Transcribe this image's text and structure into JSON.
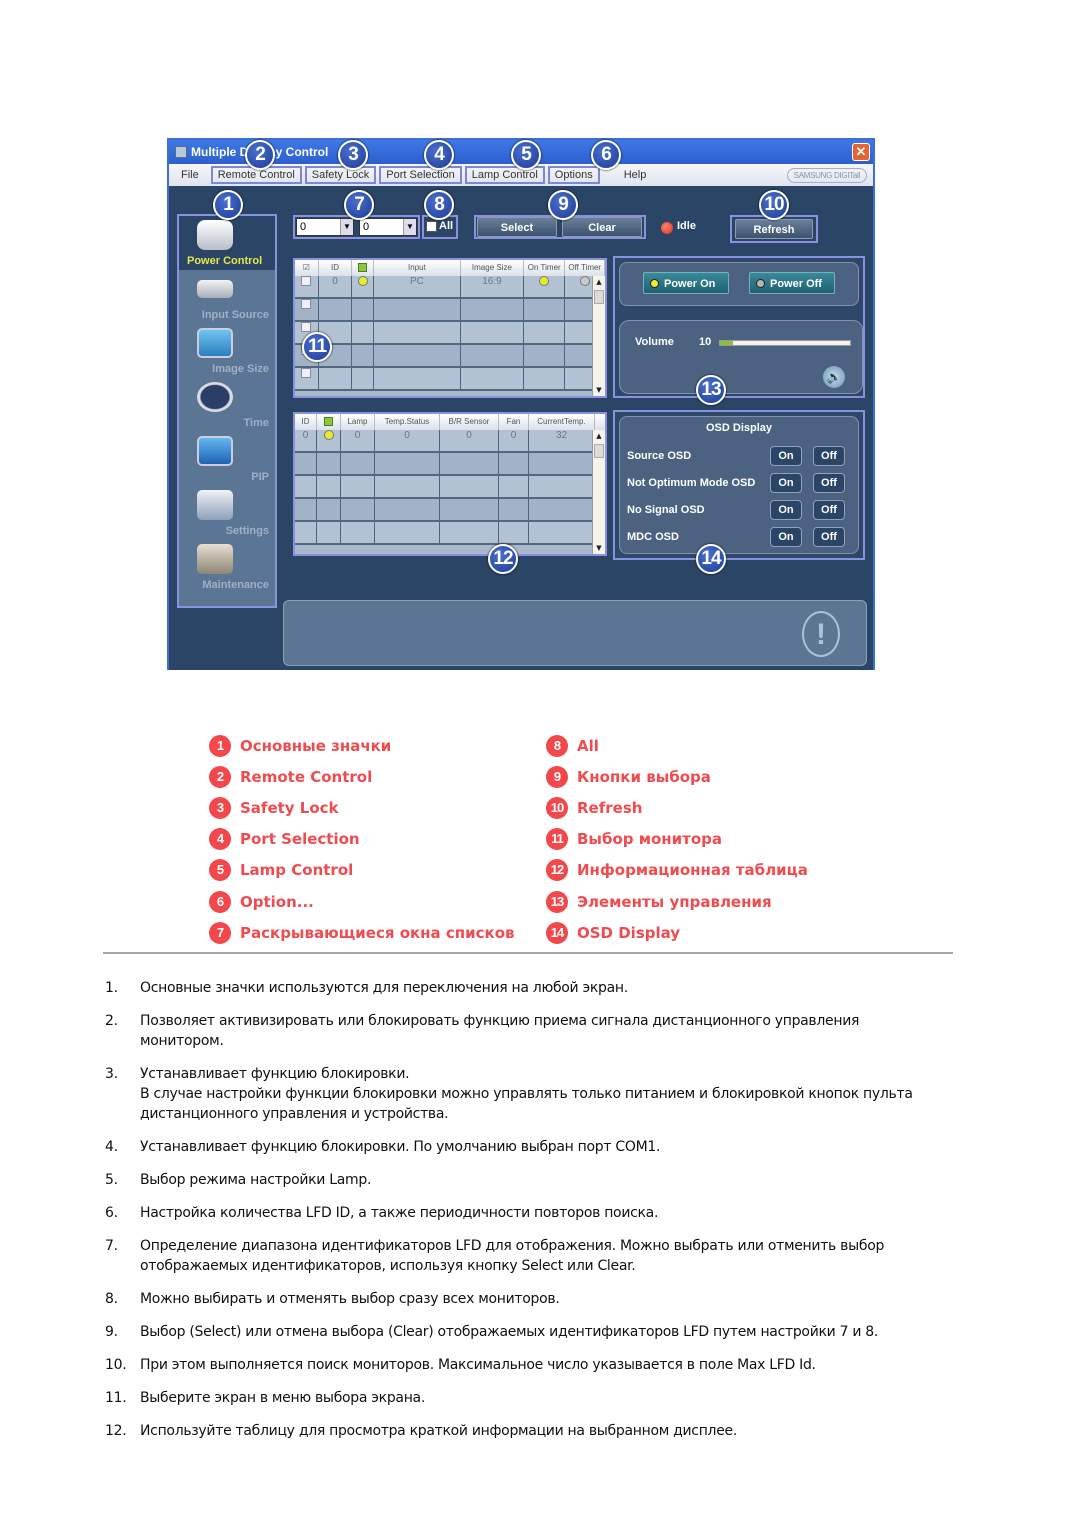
{
  "window": {
    "title": "Multiple Display Control",
    "close_glyph": "✕",
    "menu": [
      "File",
      "Remote Control",
      "Safety Lock",
      "Port Selection",
      "Lamp Control",
      "Options",
      "Help"
    ],
    "brand": "SAMSUNG DIGITall"
  },
  "sidebar": {
    "items": [
      {
        "label": "Power Control",
        "icon": "power-control-icon",
        "active": true
      },
      {
        "label": "Input Source",
        "icon": "input-source-icon"
      },
      {
        "label": "Image Size",
        "icon": "image-size-icon"
      },
      {
        "label": "Time",
        "icon": "clock-icon"
      },
      {
        "label": "PIP",
        "icon": "pip-icon"
      },
      {
        "label": "Settings",
        "icon": "settings-icon"
      },
      {
        "label": "Maintenance",
        "icon": "maintenance-icon"
      }
    ]
  },
  "controls": {
    "range_from": "0",
    "range_to": "0",
    "all_label": "All",
    "select_label": "Select",
    "clear_label": "Clear",
    "status": "Idle",
    "refresh_label": "Refresh",
    "dropdown_arrow": "▼"
  },
  "table_top": {
    "columns": [
      "☑",
      "ID",
      "",
      "Input",
      "Image Size",
      "On Timer",
      "Off Timer"
    ],
    "rows": [
      {
        "id": "0",
        "power": "on",
        "input": "PC",
        "image_size": "16:9",
        "on_timer": "on",
        "off_timer": "off"
      }
    ]
  },
  "table_bottom": {
    "columns": [
      "ID",
      "",
      "Lamp",
      "Temp.Status",
      "B/R Sensor",
      "Fan",
      "CurrentTemp."
    ],
    "rows": [
      {
        "id": "0",
        "power": "on",
        "lamp": "0",
        "temp_status": "0",
        "br_sensor": "0",
        "fan": "0",
        "current_temp": "32"
      }
    ]
  },
  "power_panel": {
    "power_on_label": "Power On",
    "power_off_label": "Power Off",
    "volume_label": "Volume",
    "volume_value": "10",
    "volume_fraction": 0.1,
    "speaker_glyph": "🔈"
  },
  "osd_panel": {
    "title": "OSD Display",
    "rows": [
      {
        "label": "Source OSD",
        "on": "On",
        "off": "Off"
      },
      {
        "label": "Not Optimum Mode OSD",
        "on": "On",
        "off": "Off"
      },
      {
        "label": "No Signal OSD",
        "on": "On",
        "off": "Off"
      },
      {
        "label": "MDC OSD",
        "on": "On",
        "off": "Off"
      }
    ]
  },
  "message_box": {
    "warning_glyph": "!"
  },
  "callouts": [
    "1",
    "2",
    "3",
    "4",
    "5",
    "6",
    "7",
    "8",
    "9",
    "10",
    "11",
    "12",
    "13",
    "14"
  ],
  "legend": {
    "left": [
      {
        "num": "1",
        "text": "Основные значки"
      },
      {
        "num": "2",
        "text": "Remote Control"
      },
      {
        "num": "3",
        "text": "Safety Lock"
      },
      {
        "num": "4",
        "text": "Port Selection"
      },
      {
        "num": "5",
        "text": "Lamp Control"
      },
      {
        "num": "6",
        "text": "Option..."
      },
      {
        "num": "7",
        "text": "Раскрывающиеся окна списков"
      }
    ],
    "right": [
      {
        "num": "8",
        "text": "All"
      },
      {
        "num": "9",
        "text": "Кнопки выбора"
      },
      {
        "num": "10",
        "text": "Refresh"
      },
      {
        "num": "11",
        "text": "Выбор монитора"
      },
      {
        "num": "12",
        "text": "Информационная таблица"
      },
      {
        "num": "13",
        "text": "Элементы управления"
      },
      {
        "num": "14",
        "text": "OSD Display"
      }
    ]
  },
  "notes": [
    {
      "n": "1.",
      "text": "Основные значки используются для переключения на любой экран."
    },
    {
      "n": "2.",
      "text": "Позволяет активизировать или блокировать функцию приема сигнала дистанционного управления монитором."
    },
    {
      "n": "3.",
      "text": "Устанавливает функцию блокировки.",
      "text2": "В случае настройки функции блокировки можно управлять только питанием и блокировкой кнопок пульта дистанционного управления и устройства."
    },
    {
      "n": "4.",
      "text": "Устанавливает функцию блокировки. По умолчанию выбран порт COM1."
    },
    {
      "n": "5.",
      "text": "Выбор режима настройки Lamp."
    },
    {
      "n": "6.",
      "text": "Настройка количества LFD ID, а также периодичности повторов поиска."
    },
    {
      "n": "7.",
      "text": "Определение диапазона идентификаторов LFD для отображения. Можно выбрать или отменить выбор отображаемых идентификаторов, используя кнопку Select или Clear."
    },
    {
      "n": "8.",
      "text": "Можно выбирать и отменять выбор сразу всех мониторов."
    },
    {
      "n": "9.",
      "text": "Выбор (Select) или отмена выбора (Clear) отображаемых идентификаторов LFD путем настройки 7 и 8."
    },
    {
      "n": "10.",
      "text": "При этом выполняется поиск мониторов. Максимальное число указывается в поле Max LFD Id."
    },
    {
      "n": "11.",
      "text": "Выберите экран в меню выбора экрана."
    },
    {
      "n": "12.",
      "text": "Используйте таблицу для просмотра краткой информации на выбранном дисплее."
    }
  ]
}
